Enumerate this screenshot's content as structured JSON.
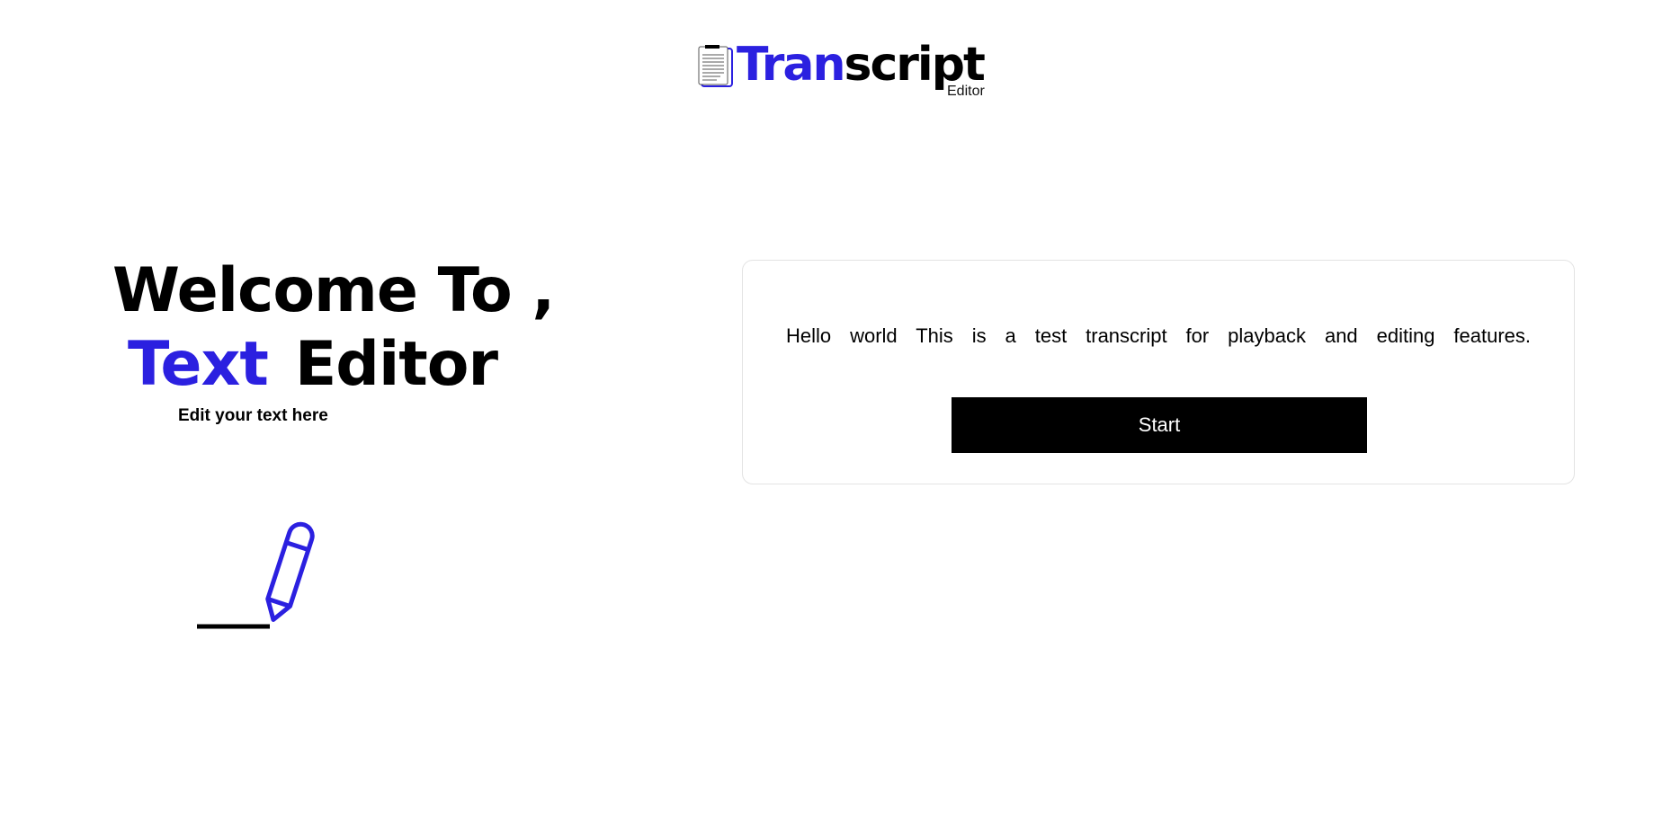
{
  "logo": {
    "icon": "document-lines-icon",
    "word_highlight": "Tran",
    "word_rest": "script",
    "subtitle": "Editor",
    "colors": {
      "accent": "#2b20e0",
      "text": "#000000"
    }
  },
  "hero": {
    "line1": "Welcome To ,",
    "line2_highlight": "Text",
    "line2_rest": "Editor",
    "tagline": "Edit your text here",
    "illustration_icon": "pencil-writing-icon"
  },
  "card": {
    "transcript": "Hello world This is a test transcript for playback and editing features.",
    "start_button_label": "Start"
  }
}
